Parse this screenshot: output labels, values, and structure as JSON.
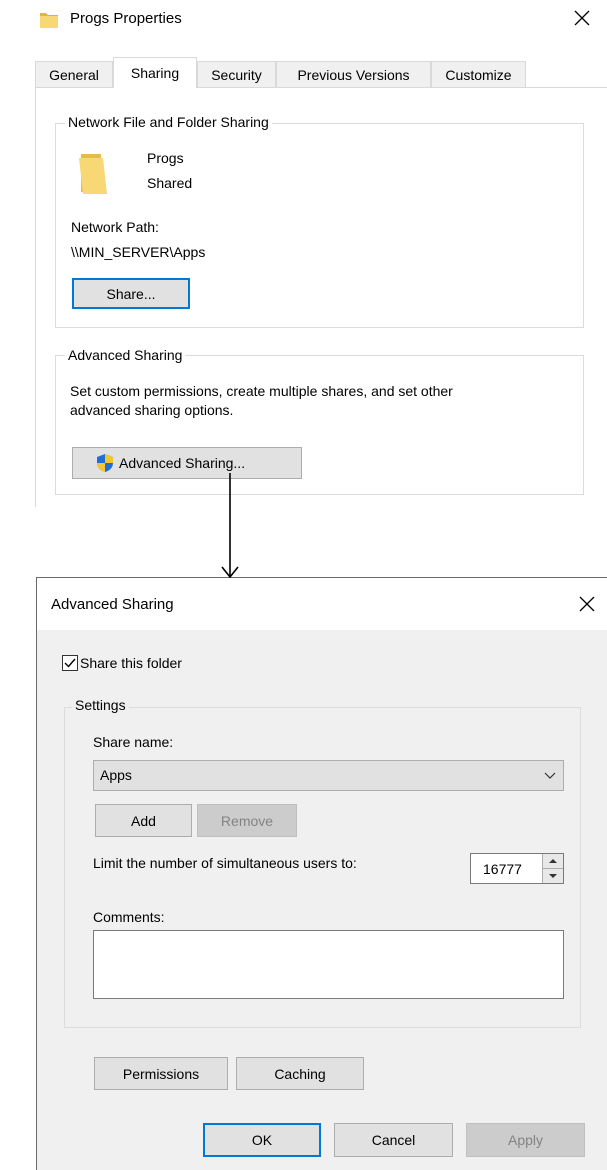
{
  "properties": {
    "title": "Progs Properties",
    "tabs": [
      "General",
      "Sharing",
      "Security",
      "Previous Versions",
      "Customize"
    ],
    "network_group": {
      "title": "Network File and Folder Sharing",
      "folder_name": "Progs",
      "folder_status": "Shared",
      "path_label": "Network Path:",
      "path_value": "\\\\MIN_SERVER\\Apps",
      "share_button": "Share..."
    },
    "advanced_group": {
      "title": "Advanced Sharing",
      "description_line1": "Set custom permissions, create multiple shares, and set other",
      "description_line2": "advanced sharing options.",
      "button": "Advanced Sharing..."
    }
  },
  "dialog": {
    "title": "Advanced Sharing",
    "share_checkbox_label": "Share this folder",
    "share_checked": true,
    "settings_group": "Settings",
    "share_name_label": "Share name:",
    "share_name_value": "Apps",
    "add_button": "Add",
    "remove_button": "Remove",
    "limit_label": "Limit the number of simultaneous users to:",
    "limit_value": "16777",
    "comments_label": "Comments:",
    "comments_value": "",
    "permissions_button": "Permissions",
    "caching_button": "Caching",
    "ok_button": "OK",
    "cancel_button": "Cancel",
    "apply_button": "Apply"
  },
  "colors": {
    "focus_border": "#0078d7",
    "dialog_background": "#f0f0f0",
    "folder_yellow": "#f8d775",
    "shield_blue": "#1f6fd6",
    "shield_yellow": "#f7c531"
  },
  "icons": [
    "folder-icon",
    "close-icon",
    "shield-icon",
    "chevron-down-icon",
    "spin-up-icon",
    "spin-down-icon",
    "checkmark-icon",
    "arrow-down-icon"
  ]
}
